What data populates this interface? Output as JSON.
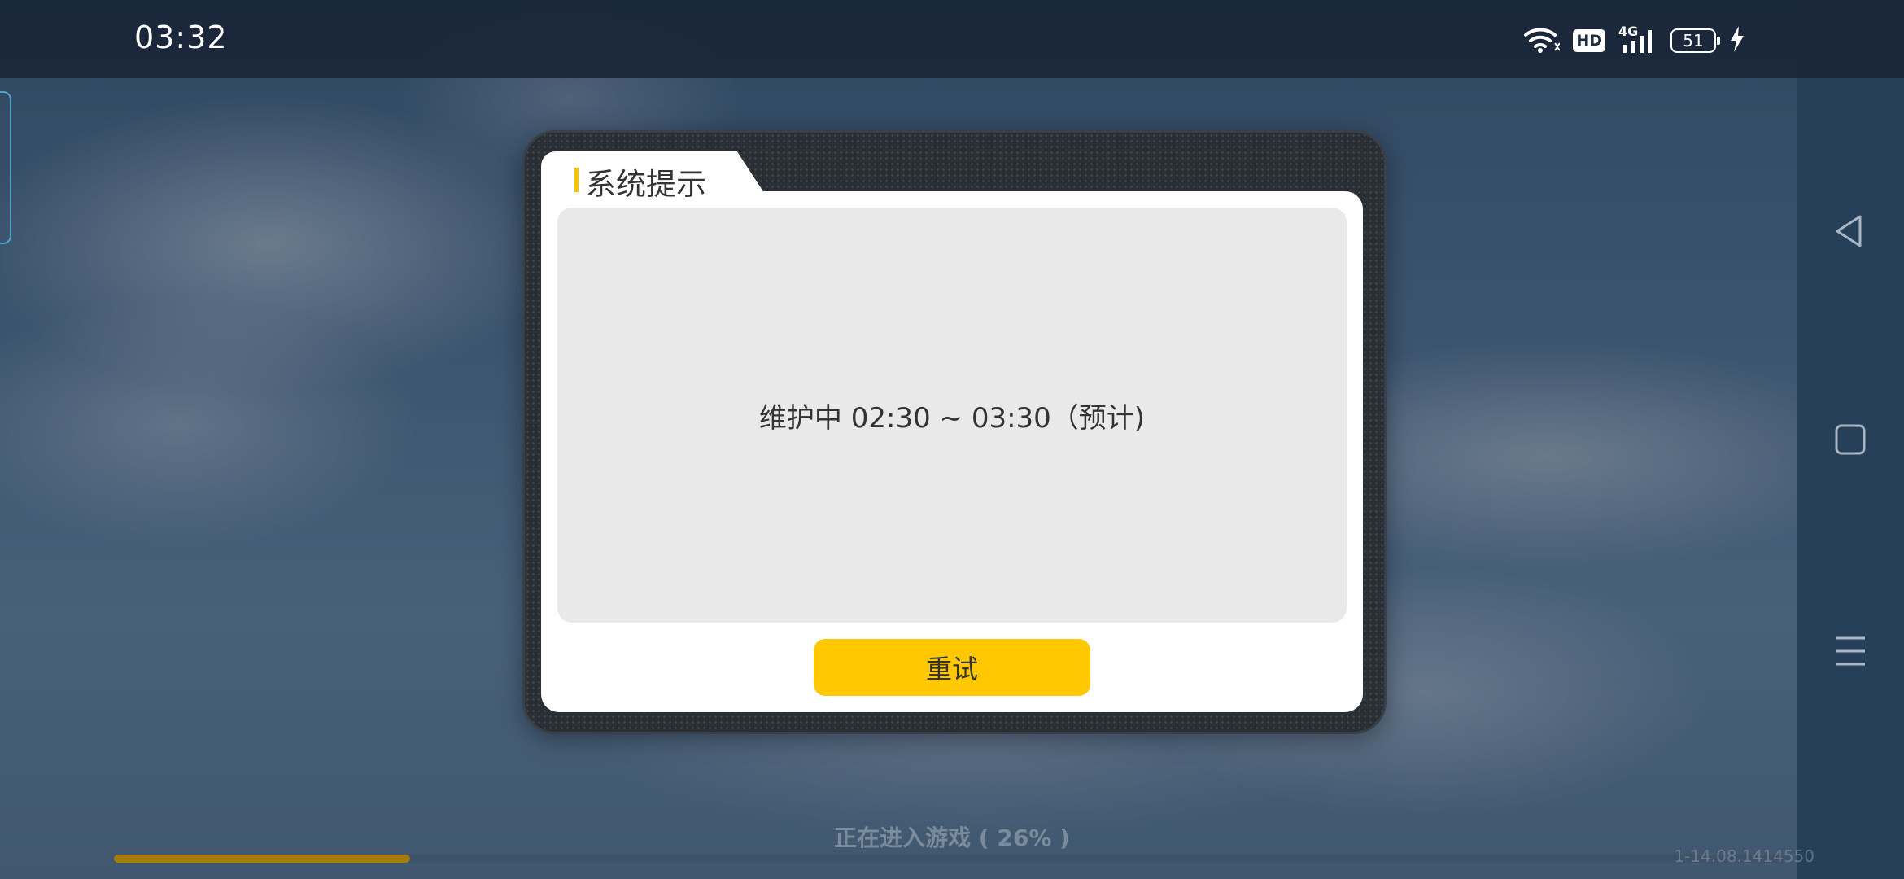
{
  "status_bar": {
    "time": "03:32",
    "network": "4G",
    "hd": "HD",
    "battery": "51",
    "icons": [
      "wifi-icon",
      "hd-icon",
      "signal-4g-icon",
      "battery-icon",
      "charging-icon"
    ]
  },
  "dialog": {
    "title": "系统提示",
    "message": "维护中 02:30 ~ 03:30（预计)",
    "retry_label": "重试"
  },
  "loading": {
    "text": "正在进入游戏 ( 26% )",
    "progress": 0.26,
    "version": "1-14.08.1414550"
  },
  "navbar": {
    "icons": [
      "back-icon",
      "home-icon",
      "menu-icon"
    ]
  },
  "colors": {
    "accent": "#ffc800",
    "title_accent": "#f5c400",
    "progress": "#a37c0a"
  }
}
